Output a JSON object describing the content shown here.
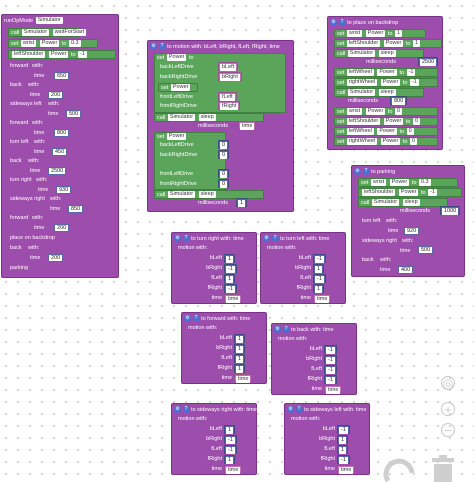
{
  "main": {
    "title": "runOpMode",
    "sim": "Simulator",
    "call": "call",
    "waitForStart": "waitForStart",
    "set": "set",
    "wrist": "wrist",
    "power": "Power",
    "to": "to",
    "wrist_power": "0.3",
    "leftShoulder": "leftShoulder",
    "shoulder_power": "-1",
    "calls": [
      {
        "name": "forward",
        "arg": "time",
        "val": "650"
      },
      {
        "name": "back",
        "arg": "time",
        "val": "200"
      },
      {
        "name": "sideways left",
        "arg": "time",
        "val": "500"
      },
      {
        "name": "forward",
        "arg": "time",
        "val": "800"
      },
      {
        "name": "turn left",
        "arg": "time",
        "val": "450"
      },
      {
        "name": "back",
        "arg": "time",
        "val": "2500"
      },
      {
        "name": "turn right",
        "arg": "time",
        "val": "930"
      },
      {
        "name": "sideways right",
        "arg": "time",
        "val": "850"
      },
      {
        "name": "forward",
        "arg": "time",
        "val": "200"
      },
      {
        "name": "place on backdrop",
        "arg": "",
        "val": ""
      },
      {
        "name": "back",
        "arg": "time",
        "val": "200"
      },
      {
        "name": "parking",
        "arg": "",
        "val": ""
      }
    ],
    "with": "with:"
  },
  "motion": {
    "title": "to motion with: bLeft, bRight, fLeft, fRight, time",
    "rows1": [
      {
        "var": "backLeftDrive",
        "param": "bLeft"
      },
      {
        "var": "backRightDrive",
        "param": "bRight"
      },
      {
        "var": "frontLeftDrive",
        "param": "fLeft"
      },
      {
        "var": "frontRightDrive",
        "param": "fRight"
      }
    ],
    "sleep": "sleep",
    "milliseconds": "milliseconds",
    "time": "time",
    "rows2": [
      {
        "var": "backLeftDrive",
        "val": "0"
      },
      {
        "var": "backRightDrive",
        "val": "0"
      },
      {
        "var": "frontLeftDrive",
        "val": "0"
      },
      {
        "var": "frontRightDrive",
        "val": "0"
      }
    ],
    "sleep_ms": "1"
  },
  "backdrop": {
    "title": "to place on backdrop",
    "wrist_val": "1",
    "shoulder_val": "1",
    "sleep1": "2500",
    "wheels1": [
      {
        "var": "leftWheel",
        "val": "-1"
      },
      {
        "var": "rightWheel",
        "val": "-1"
      }
    ],
    "sleep2": "800",
    "final": [
      {
        "var": "wrist",
        "val": "0"
      },
      {
        "var": "leftShoulder",
        "val": "0"
      },
      {
        "var": "leftWheel",
        "val": "0"
      },
      {
        "var": "rightWheel",
        "val": "0"
      }
    ]
  },
  "parking": {
    "title": "to parking",
    "wrist_val": "0.3",
    "shoulder_val": "-1",
    "sleep": "1000",
    "calls": [
      {
        "name": "turn left",
        "arg": "time",
        "val": "920"
      },
      {
        "name": "sideways right",
        "arg": "time",
        "val": "500"
      },
      {
        "name": "back",
        "arg": "time",
        "val": "400"
      }
    ]
  },
  "funcs": [
    {
      "id": "turn-right",
      "title": "to turn right with: time",
      "vals": [
        "1",
        "-1",
        "1",
        "-1"
      ]
    },
    {
      "id": "turn-left",
      "title": "to turn left with: time",
      "vals": [
        "-1",
        "1",
        "-1",
        "1"
      ]
    },
    {
      "id": "forward",
      "title": "to forward with: time",
      "vals": [
        "1",
        "1",
        "1",
        "1"
      ]
    },
    {
      "id": "back",
      "title": "to back with: time",
      "vals": [
        "-1",
        "-1",
        "-1",
        "-1"
      ]
    },
    {
      "id": "sideways-right",
      "title": "to sideways right with: time",
      "vals": [
        "1",
        "-1",
        "-1",
        "1"
      ]
    },
    {
      "id": "sideways-left",
      "title": "to sideways left with: time",
      "vals": [
        "-1",
        "1",
        "1",
        "-1"
      ]
    }
  ],
  "func_labels": {
    "motion_with": "motion with:",
    "params": [
      "bLeft",
      "bRight",
      "fLeft",
      "fRight",
      "time"
    ],
    "time_arg": "time"
  },
  "controls": {
    "center": "◎",
    "zoom_in": "+",
    "zoom_out": "−"
  }
}
